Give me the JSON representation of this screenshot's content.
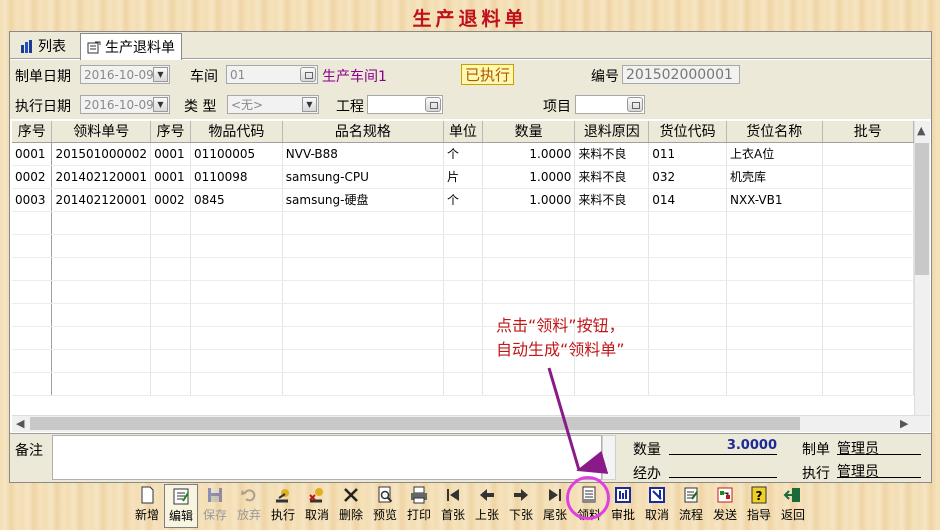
{
  "title": "生产退料单",
  "tabs": [
    {
      "label": "列表"
    },
    {
      "label": "生产退料单"
    }
  ],
  "form": {
    "make_date_label": "制单日期",
    "make_date": "2016-10-09",
    "workshop_label": "车间",
    "workshop_code": "01",
    "workshop_name": "生产车间1",
    "status": "已执行",
    "number_label": "编号",
    "number": "201502000001",
    "exec_date_label": "执行日期",
    "exec_date": "2016-10-09",
    "type_label": "类 型",
    "type_value": "<无>",
    "project_label": "工程",
    "project_value": "",
    "item_label": "项目",
    "item_value": ""
  },
  "table": {
    "columns": [
      "序号",
      "领料单号",
      "序号",
      "物品代码",
      "品名规格",
      "单位",
      "数量",
      "退料原因",
      "货位代码",
      "货位名称",
      "批号"
    ],
    "rows": [
      [
        "0001",
        "201501000002",
        "0001",
        "01100005",
        "NVV-B88",
        "个",
        "1.0000",
        "来料不良",
        "011",
        "上衣A位",
        ""
      ],
      [
        "0002",
        "201402120001",
        "0001",
        "0110098",
        "samsung-CPU",
        "片",
        "1.0000",
        "来料不良",
        "032",
        "机壳库",
        ""
      ],
      [
        "0003",
        "201402120001",
        "0002",
        "0845",
        "samsung-硬盘",
        "个",
        "1.0000",
        "来料不良",
        "014",
        "NXX-VB1",
        ""
      ]
    ]
  },
  "footer": {
    "note_label": "备注",
    "note_value": "",
    "qty_label": "数量",
    "qty_value": "3.0000",
    "handler_label": "经办",
    "handler_value": "",
    "maker_label": "制单",
    "maker_value": "管理员",
    "executor_label": "执行",
    "executor_value": "管理员"
  },
  "annotation": {
    "line1": "点击“领料”按钮，",
    "line2": "自动生成“领料单”"
  },
  "toolbar": [
    {
      "label": "新增",
      "icon": "new-icon",
      "enabled": true
    },
    {
      "label": "编辑",
      "icon": "edit-icon",
      "enabled": true
    },
    {
      "label": "保存",
      "icon": "save-icon",
      "enabled": false
    },
    {
      "label": "放弃",
      "icon": "undo-icon",
      "enabled": false
    },
    {
      "label": "执行",
      "icon": "execute-icon",
      "enabled": true
    },
    {
      "label": "取消",
      "icon": "cancel-icon",
      "enabled": true
    },
    {
      "label": "删除",
      "icon": "delete-icon",
      "enabled": true
    },
    {
      "label": "预览",
      "icon": "preview-icon",
      "enabled": true
    },
    {
      "label": "打印",
      "icon": "print-icon",
      "enabled": true
    },
    {
      "label": "首张",
      "icon": "first-icon",
      "enabled": true
    },
    {
      "label": "上张",
      "icon": "prev-icon",
      "enabled": true
    },
    {
      "label": "下张",
      "icon": "next-icon",
      "enabled": true
    },
    {
      "label": "尾张",
      "icon": "last-icon",
      "enabled": true
    },
    {
      "label": "领料",
      "icon": "material-requisition-icon",
      "enabled": true
    },
    {
      "label": "审批",
      "icon": "approve-icon",
      "enabled": true
    },
    {
      "label": "取消",
      "icon": "cancel-approve-icon",
      "enabled": true
    },
    {
      "label": "流程",
      "icon": "workflow-icon",
      "enabled": true
    },
    {
      "label": "发送",
      "icon": "send-icon",
      "enabled": true
    },
    {
      "label": "指导",
      "icon": "guide-icon",
      "enabled": true
    },
    {
      "label": "返回",
      "icon": "return-icon",
      "enabled": true
    }
  ]
}
